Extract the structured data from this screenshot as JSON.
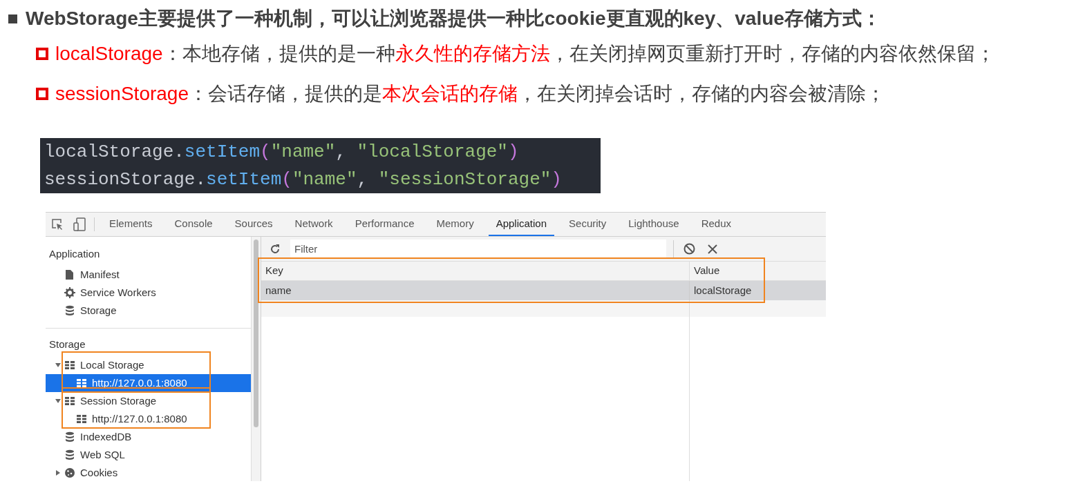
{
  "heading": "WebStorage主要提供了一种机制，可以让浏览器提供一种比cookie更直观的key、value存储方式：",
  "points": [
    {
      "segments": [
        {
          "text": "localStorage",
          "emphasis": true
        },
        {
          "text": "：本地存储，提供的是一种",
          "emphasis": false
        },
        {
          "text": "永久性的存储方法",
          "emphasis": true
        },
        {
          "text": "，在关闭掉网页重新打开时，存储的内容依然保留；",
          "emphasis": false
        }
      ]
    },
    {
      "segments": [
        {
          "text": "sessionStorage",
          "emphasis": true
        },
        {
          "text": "：会话存储，提供的是",
          "emphasis": false
        },
        {
          "text": "本次会话的存储",
          "emphasis": true
        },
        {
          "text": "，在关闭掉会话时，存储的内容会被清除；",
          "emphasis": false
        }
      ]
    }
  ],
  "code_lines": [
    {
      "tokens": [
        {
          "kind": "plain",
          "text": "localStorage."
        },
        {
          "kind": "method",
          "text": "setItem"
        },
        {
          "kind": "paren",
          "text": "("
        },
        {
          "kind": "string",
          "text": "\"name\""
        },
        {
          "kind": "plain",
          "text": ", "
        },
        {
          "kind": "string",
          "text": "\"localStorage\""
        },
        {
          "kind": "paren",
          "text": ")"
        }
      ]
    },
    {
      "tokens": [
        {
          "kind": "plain",
          "text": "sessionStorage."
        },
        {
          "kind": "method",
          "text": "setItem"
        },
        {
          "kind": "paren",
          "text": "("
        },
        {
          "kind": "string",
          "text": "\"name\""
        },
        {
          "kind": "plain",
          "text": ", "
        },
        {
          "kind": "string",
          "text": "\"sessionStorage\""
        },
        {
          "kind": "paren",
          "text": ")"
        }
      ]
    }
  ],
  "devtools": {
    "tabs": [
      {
        "label": "Elements",
        "selected": false
      },
      {
        "label": "Console",
        "selected": false
      },
      {
        "label": "Sources",
        "selected": false
      },
      {
        "label": "Network",
        "selected": false
      },
      {
        "label": "Performance",
        "selected": false
      },
      {
        "label": "Memory",
        "selected": false
      },
      {
        "label": "Application",
        "selected": true
      },
      {
        "label": "Security",
        "selected": false
      },
      {
        "label": "Lighthouse",
        "selected": false
      },
      {
        "label": "Redux",
        "selected": false
      }
    ],
    "sidebar": [
      {
        "title": "Application",
        "items": [
          {
            "label": "Manifest",
            "kind": "file",
            "selected": false,
            "highlighted": false
          },
          {
            "label": "Service Workers",
            "kind": "gear",
            "selected": false,
            "highlighted": false
          },
          {
            "label": "Storage",
            "kind": "database",
            "selected": false,
            "highlighted": false
          }
        ]
      },
      {
        "title": "Storage",
        "items": [
          {
            "label": "Local Storage",
            "kind": "table",
            "selected": false,
            "highlighted": true,
            "expanded": true,
            "children": [
              {
                "label": "http://127.0.0.1:8080",
                "kind": "table",
                "selected": true
              }
            ]
          },
          {
            "label": "Session Storage",
            "kind": "table",
            "selected": false,
            "highlighted": true,
            "expanded": true,
            "children": [
              {
                "label": "http://127.0.0.1:8080",
                "kind": "table",
                "selected": false
              }
            ]
          },
          {
            "label": "IndexedDB",
            "kind": "database",
            "selected": false,
            "highlighted": false
          },
          {
            "label": "Web SQL",
            "kind": "database",
            "selected": false,
            "highlighted": false
          },
          {
            "label": "Cookies",
            "kind": "cookie",
            "selected": false,
            "highlighted": false,
            "expanded": false
          }
        ]
      }
    ],
    "filter": {
      "placeholder": "Filter"
    },
    "table": {
      "highlighted": true,
      "columns": [
        "Key",
        "Value"
      ],
      "rows": [
        {
          "cells": [
            "name",
            "localStorage"
          ],
          "selected": true
        }
      ]
    }
  }
}
